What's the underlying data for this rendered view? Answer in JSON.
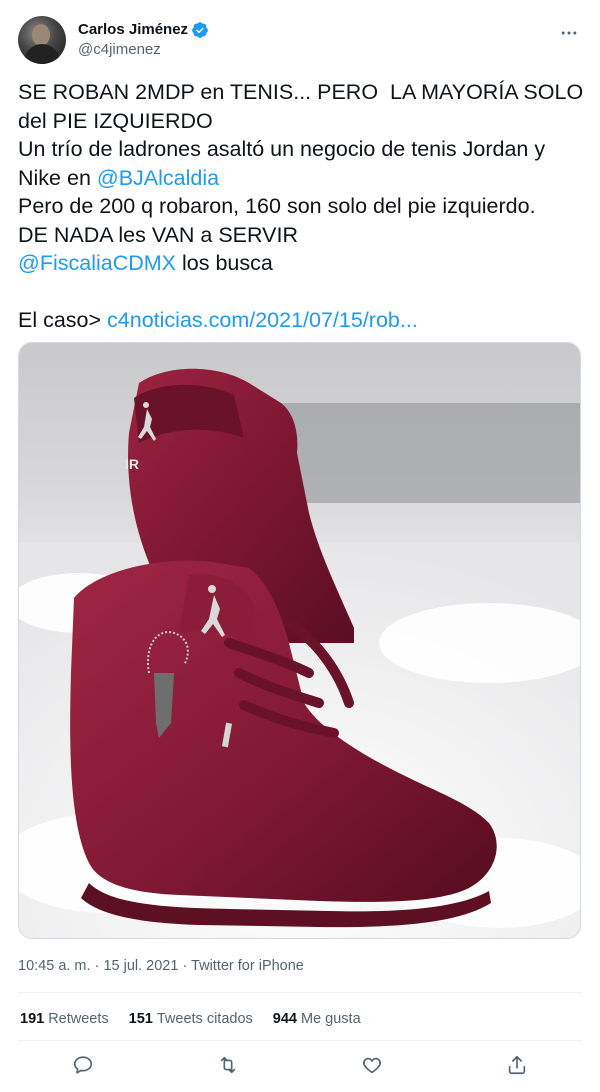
{
  "author": {
    "name": "Carlos Jiménez",
    "handle": "@c4jimenez"
  },
  "tweet": {
    "line1": "SE ROBAN 2MDP en TENIS... PERO  LA MAYORÍA SOLO del PIE IZQUIERDO",
    "line2": "Un trío de ladrones asaltó un negocio de tenis Jordan y Nike en ",
    "mention1": "@BJAlcaldia",
    "line3": "Pero de 200 q robaron, 160 son solo del pie izquierdo.",
    "line4": "DE NADA les VAN a SERVIR",
    "mention2": "@FiscaliaCDMX",
    "line5": " los busca",
    "case_prefix": "El caso> ",
    "link": "c4noticias.com/2021/07/15/rob..."
  },
  "media": {
    "icon_text": "IR"
  },
  "meta": {
    "time": "10:45 a. m.",
    "dot": " · ",
    "date": "15 jul. 2021",
    "dot2": " · ",
    "source": "Twitter for iPhone"
  },
  "stats": {
    "retweets_count": "191",
    "retweets_label": "Retweets",
    "quotes_count": "151",
    "quotes_label": "Tweets citados",
    "likes_count": "944",
    "likes_label": "Me gusta"
  },
  "colors": {
    "accent": "#1d9bf0",
    "shoe": "#7a1830"
  }
}
